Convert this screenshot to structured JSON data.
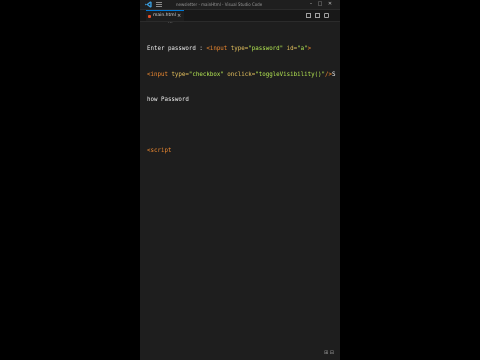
{
  "app": {
    "window_title": "newsletter - mainHtml - Visual Studio Code",
    "colors": {
      "accent": "#0078d4",
      "tag": "#f28b30",
      "attr": "#e7c35f",
      "string": "#b5e853",
      "background": "#1e1e1e"
    }
  },
  "icons": {
    "logo": "vscode-logo-icon",
    "menu": "hamburger-menu-icon",
    "file": "html-file-icon",
    "close": "close-icon",
    "split": "split-editor-icon",
    "layout": "layout-icon"
  },
  "window_controls": {
    "minimize": "–",
    "maximize": "□",
    "close": "✕"
  },
  "tabs": [
    {
      "label": "main.html",
      "close": "×"
    }
  ],
  "breadcrumb": {
    "dots": "···"
  },
  "editor": {
    "line1": {
      "text1": "Enter password : ",
      "tag_open": "<input",
      "attr1": " type=",
      "str1": "\"password\"",
      "attr2": " id=",
      "str2": "\"a\"",
      "tag_close": ">"
    },
    "line2": {
      "tag_open": "<input",
      "attr1": " type=",
      "str1": "\"checkbox\"",
      "attr2": " onclick=",
      "str2": "\"toggleVisibility()\"",
      "tag_close": "/>",
      "text_end": "S"
    },
    "line3": {
      "text": "how Password"
    },
    "line4": {
      "text": ""
    },
    "line5": {
      "tag_open": "<script"
    }
  },
  "status": {
    "icon_text": "⊞ ⊟"
  }
}
